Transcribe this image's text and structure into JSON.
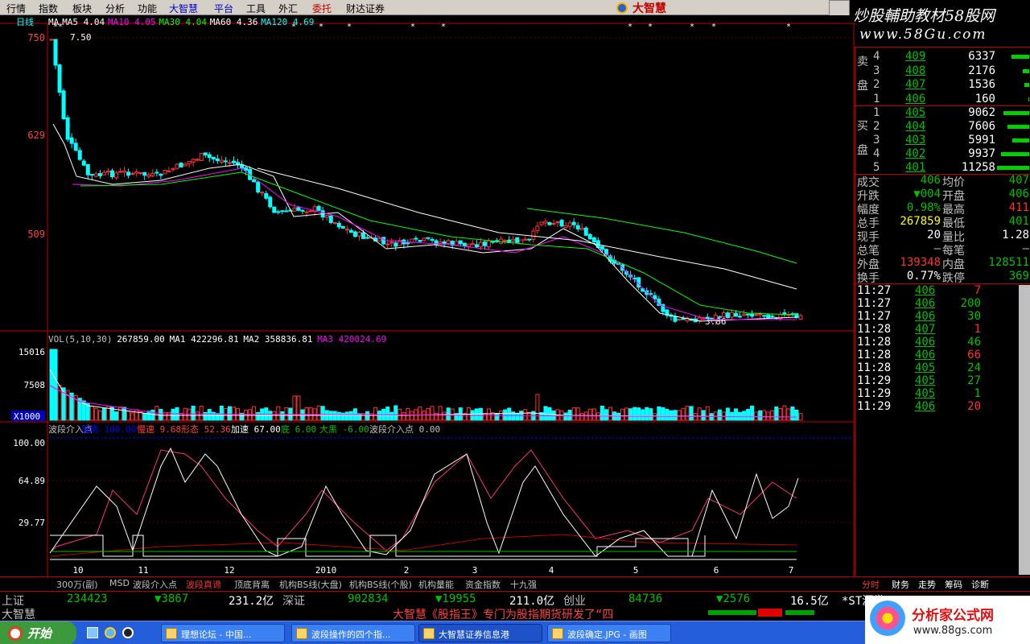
{
  "menu": [
    "行情",
    "指数",
    "板块",
    "分析",
    "功能",
    "大智慧",
    "平台",
    "工具",
    "外汇",
    "委托",
    "财达证券"
  ],
  "menu_highlight": {
    "大智慧": "#0000c0",
    "平台": "#0000c0",
    "委托": "#c00000"
  },
  "brand": "大智慧",
  "ad_top": {
    "line1": "炒股輔助教材58股网",
    "line2": "www.58Gu.com"
  },
  "chart": {
    "period": "日线",
    "ma_legend": [
      {
        "text": "MA",
        "color": "#ffffff"
      },
      {
        "text": "MA5 4.04",
        "color": "#ffffff"
      },
      {
        "text": "MA10 4.05",
        "color": "#ff00ff"
      },
      {
        "text": "MA30 4.04",
        "color": "#00ff00"
      },
      {
        "text": "MA60 4.36",
        "color": "#ffffff"
      },
      {
        "text": "MA120 4.69",
        "color": "#00ffff"
      }
    ],
    "price_axis": [
      "750",
      "629",
      "509"
    ],
    "high_label": "7.50",
    "low_label": "3.86",
    "vol_legend": [
      {
        "text": "VOL(5,10,30)",
        "color": "#c0c0c0"
      },
      {
        "text": "267859.00",
        "color": "#ffffff"
      },
      {
        "text": "MA1 422296.81",
        "color": "#ffffff"
      },
      {
        "text": "MA2 358836.81",
        "color": "#ffffff"
      },
      {
        "text": "MA3 420024.69",
        "color": "#ff00ff"
      }
    ],
    "vol_axis": [
      "15016",
      "7508"
    ],
    "vol_unit": "X1000",
    "ind_legend": [
      {
        "text": "波段介入点",
        "color": "#c0c0c0"
      },
      {
        "text": "强势 100.00",
        "color": "#0000ff"
      },
      {
        "text": "慢速 9.68",
        "color": "#ff4040"
      },
      {
        "text": "形态 52.36",
        "color": "#ff4040"
      },
      {
        "text": "加速 67.00",
        "color": "#ffffff"
      },
      {
        "text": "底 6.00",
        "color": "#00c000"
      },
      {
        "text": "大黑 -6.00",
        "color": "#00c000"
      },
      {
        "text": "波段介入点 0.00",
        "color": "#c0c0c0"
      }
    ],
    "ind_axis": [
      "100.00",
      "64.89",
      "29.77"
    ],
    "x_labels": [
      "10",
      "11",
      "12",
      "2010",
      "2",
      "3",
      "4",
      "5",
      "6",
      "7"
    ]
  },
  "orderbook": {
    "sell_label": "卖盘",
    "buy_label": "买盘",
    "sell": [
      {
        "level": "4",
        "price": "409",
        "vol": "6337",
        "bar": 0.56
      },
      {
        "level": "3",
        "price": "408",
        "vol": "2176",
        "bar": 0.19
      },
      {
        "level": "2",
        "price": "407",
        "vol": "1536",
        "bar": 0.14
      },
      {
        "level": "1",
        "price": "406",
        "vol": "160",
        "bar": 0.02
      }
    ],
    "buy": [
      {
        "level": "1",
        "price": "405",
        "vol": "9062",
        "bar": 0.8
      },
      {
        "level": "2",
        "price": "404",
        "vol": "7606",
        "bar": 0.67
      },
      {
        "level": "3",
        "price": "403",
        "vol": "5991",
        "bar": 0.53
      },
      {
        "level": "4",
        "price": "402",
        "vol": "9937",
        "bar": 0.88
      },
      {
        "level": "5",
        "price": "401",
        "vol": "11258",
        "bar": 1.0
      }
    ]
  },
  "stats": [
    {
      "k1": "成交",
      "v1": "406",
      "k2": "均价",
      "v2": "407",
      "c1": "#00c000",
      "c2": "#00c000"
    },
    {
      "k1": "升跌",
      "v1": "▼004",
      "k2": "开盘",
      "v2": "406",
      "c1": "#00c000",
      "c2": "#00c000"
    },
    {
      "k1": "幅度",
      "v1": "0.98%",
      "k2": "最高",
      "v2": "411",
      "c1": "#00c000",
      "c2": "#ff3030"
    },
    {
      "k1": "总手",
      "v1": "267859",
      "k2": "最低",
      "v2": "401",
      "c1": "#ffff00",
      "c2": "#00c000"
    },
    {
      "k1": "现手",
      "v1": "20",
      "k2": "量比",
      "v2": "1.28",
      "c1": "#ffffff",
      "c2": "#ffffff"
    },
    {
      "k1": "总笔",
      "v1": "—",
      "k2": "每笔",
      "v2": "—",
      "c1": "#c0c0c0",
      "c2": "#c0c0c0"
    },
    {
      "k1": "外盘",
      "v1": "139348",
      "k2": "内盘",
      "v2": "128511",
      "c1": "#ff3030",
      "c2": "#00c000"
    },
    {
      "k1": "换手",
      "v1": "0.77%",
      "k2": "跌停",
      "v2": "369",
      "c1": "#ffffff",
      "c2": "#00c000"
    }
  ],
  "ticks": [
    {
      "time": "11:27",
      "price": "406",
      "vol": "7",
      "vc": "#ff3030"
    },
    {
      "time": "11:27",
      "price": "406",
      "vol": "200",
      "vc": "#00c000"
    },
    {
      "time": "11:27",
      "price": "406",
      "vol": "30",
      "vc": "#00c000"
    },
    {
      "time": "11:28",
      "price": "407",
      "vol": "1",
      "vc": "#ff3030"
    },
    {
      "time": "11:28",
      "price": "406",
      "vol": "46",
      "vc": "#00c000"
    },
    {
      "time": "11:28",
      "price": "406",
      "vol": "66",
      "vc": "#ff3030"
    },
    {
      "time": "11:28",
      "price": "405",
      "vol": "24",
      "vc": "#00c000"
    },
    {
      "time": "11:29",
      "price": "405",
      "vol": "27",
      "vc": "#00c000"
    },
    {
      "time": "11:29",
      "price": "405",
      "vol": "1",
      "vc": "#00c000"
    },
    {
      "time": "11:29",
      "price": "406",
      "vol": "20",
      "vc": "#ff3030"
    }
  ],
  "bottom_tabs": [
    "300万(副)",
    "MSD",
    "波段介入点",
    "波段真谛",
    "顶底背离",
    "机构BS线(大盘)",
    "机构BS线(个股)",
    "机构量能",
    "资金指数",
    "十九强"
  ],
  "active_tab": "波段真谛",
  "right_tabs": [
    "分时",
    "财务",
    "走势",
    "筹码",
    "诊断"
  ],
  "index_bar": [
    {
      "name": "上证",
      "vol": "234423",
      "chg": "▼3867",
      "amt": "231.2亿"
    },
    {
      "name": "深证",
      "vol": "902834",
      "chg": "▼19955",
      "amt": "211.0亿"
    },
    {
      "name": "创业",
      "vol": "84736",
      "chg": "▼2576",
      "amt": "16.5亿"
    }
  ],
  "index_tail": "*ST源发",
  "status_left": "大智慧",
  "status_marquee": "大智慧《股指王》专门为股指期货研发了“四",
  "taskbar": {
    "start": "开始",
    "buttons": [
      "理想论坛 - 中国...",
      "波段操作的四个指...",
      "大智慧证券信息港",
      "波段确定.JPG - 画图"
    ],
    "active": 2
  },
  "ad_bottom": {
    "title": "分析家公式网",
    "url": "www.88gs.com"
  }
}
